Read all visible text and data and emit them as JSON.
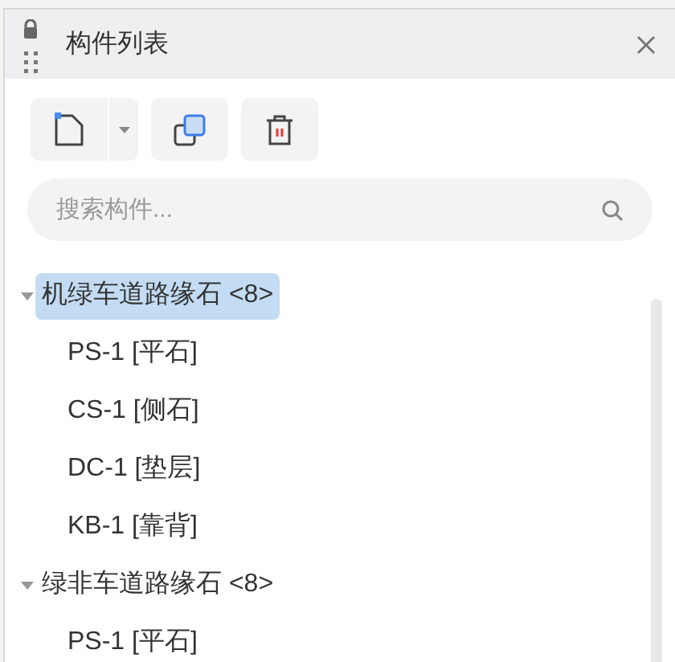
{
  "panel": {
    "title": "构件列表"
  },
  "search": {
    "placeholder": "搜索构件..."
  },
  "tree": [
    {
      "label": "机绿车道路缘石 <8>",
      "selected": true,
      "expanded": true,
      "children": [
        {
          "label": "PS-1 [平石]",
          "selected": false
        },
        {
          "label": "CS-1 [侧石]",
          "selected": false
        },
        {
          "label": "DC-1 [垫层]",
          "selected": false
        },
        {
          "label": "KB-1 [靠背]",
          "selected": false
        }
      ]
    },
    {
      "label": "绿非车道路缘石 <8>",
      "selected": false,
      "expanded": true,
      "children": [
        {
          "label": "PS-1 [平石]",
          "selected": false
        }
      ]
    }
  ]
}
